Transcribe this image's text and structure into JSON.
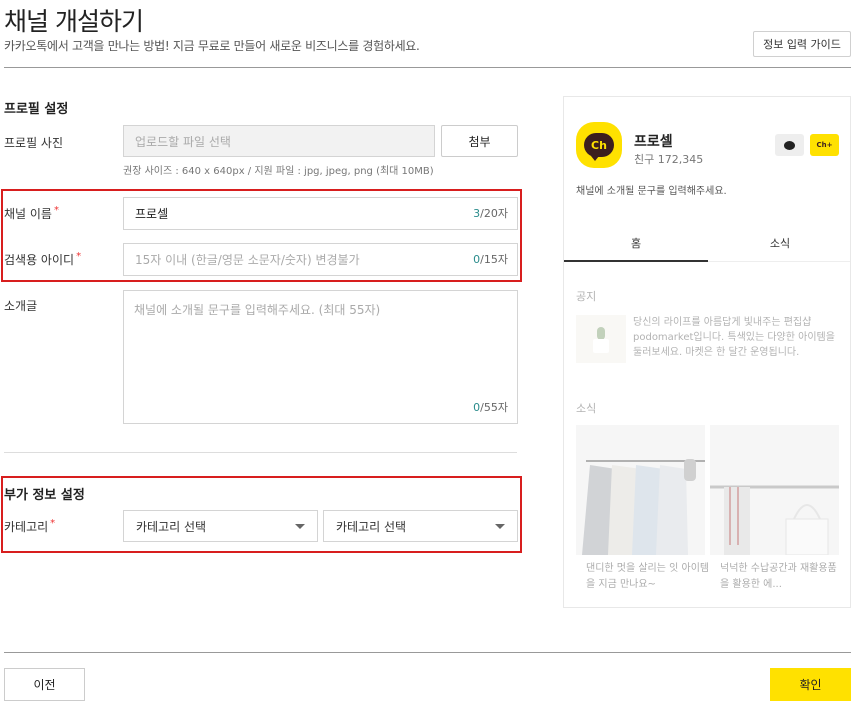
{
  "header": {
    "title": "채널 개설하기",
    "subtitle": "카카오톡에서 고객을 만나는 방법! 지금 무료로 만들어 새로운 비즈니스를 경험하세요.",
    "guide_button": "정보 입력 가이드"
  },
  "profile": {
    "section_title": "프로필 설정",
    "photo_label": "프로필 사진",
    "photo_placeholder": "업로드할 파일 선택",
    "attach_button": "첨부",
    "photo_hint": "권장 사이즈 : 640 x 640px / 지원 파일 : jpg, jpeg, png (최대 10MB)",
    "channel_name_label": "채널 이름",
    "channel_name_value": "프로셀",
    "channel_name_count": "3",
    "channel_name_max": "/20자",
    "search_id_label": "검색용 아이디",
    "search_id_placeholder": "15자 이내 (한글/영문 소문자/숫자) 변경불가",
    "search_id_count": "0",
    "search_id_max": "/15자",
    "intro_label": "소개글",
    "intro_placeholder": "채널에 소개될 문구를 입력해주세요. (최대 55자)",
    "intro_count": "0",
    "intro_max": "/55자",
    "required_mark": "*"
  },
  "extra": {
    "section_title": "부가 정보 설정",
    "category_label": "카테고리",
    "category1": "카테고리 선택",
    "category2": "카테고리 선택"
  },
  "footer": {
    "prev_button": "이전",
    "confirm_button": "확인"
  },
  "preview": {
    "logo_text": "Ch",
    "channel_name": "프로셀",
    "friends": "친구 172,345",
    "add_badge": "Ch+",
    "intro": "채널에 소개될 문구를 입력해주세요.",
    "tabs": [
      "홈",
      "소식"
    ],
    "notice_title": "공지",
    "notice_text": "당신의 라이프를 아름답게 빛내주는 편집샵 podomarket입니다. 특색있는 다양한 아이템을 둘러보세요. 마켓은 한 달간 운영됩니다.",
    "news_title": "소식",
    "news": [
      {
        "caption": "댄디한 멋을 살리는 잇 아이템을 지금 만나요~"
      },
      {
        "caption": "넉넉한 수납공간과 재활용품을 활용한 에..."
      }
    ]
  },
  "colors": {
    "kakao_yellow": "#ffe100",
    "highlight_red": "#d81e1e",
    "counter_teal": "#2a8c8c"
  }
}
